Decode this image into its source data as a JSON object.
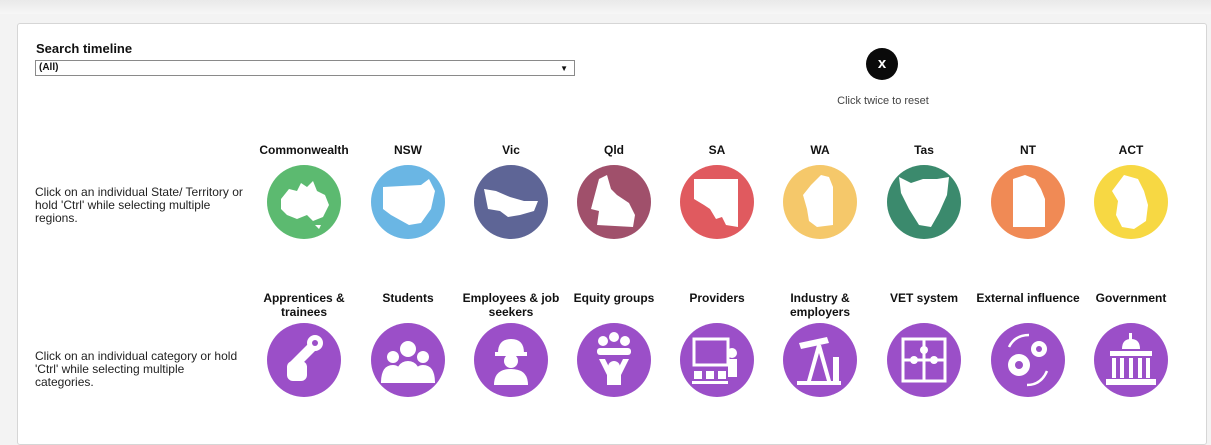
{
  "search": {
    "label": "Search timeline",
    "value": "(All)",
    "dropdown_arrow": "▼"
  },
  "reset": {
    "button_label": "x",
    "hint": "Click twice to reset"
  },
  "regions": {
    "instruction": "Click on an individual State/ Territory or hold 'Ctrl' while selecting multiple regions.",
    "items": [
      {
        "label": "Commonwealth",
        "color": "#5cba70",
        "icon": "australia-map-icon"
      },
      {
        "label": "NSW",
        "color": "#6ab6e4",
        "icon": "nsw-map-icon"
      },
      {
        "label": "Vic",
        "color": "#5e6596",
        "icon": "vic-map-icon"
      },
      {
        "label": "Qld",
        "color": "#a0506b",
        "icon": "qld-map-icon"
      },
      {
        "label": "SA",
        "color": "#e05a5f",
        "icon": "sa-map-icon"
      },
      {
        "label": "WA",
        "color": "#f5c86a",
        "icon": "wa-map-icon"
      },
      {
        "label": "Tas",
        "color": "#3b8a6d",
        "icon": "tas-map-icon"
      },
      {
        "label": "NT",
        "color": "#f08a55",
        "icon": "nt-map-icon"
      },
      {
        "label": "ACT",
        "color": "#f7d843",
        "icon": "act-map-icon"
      }
    ]
  },
  "categories": {
    "instruction": "Click on an individual category or hold 'Ctrl' while selecting multiple categories.",
    "color": "#9b4fc8",
    "items": [
      {
        "label": "Apprentices & trainees",
        "icon": "wrench-hand-icon"
      },
      {
        "label": "Students",
        "icon": "group-people-icon"
      },
      {
        "label": "Employees & job seekers",
        "icon": "hardhat-worker-icon"
      },
      {
        "label": "Equity groups",
        "icon": "community-icon"
      },
      {
        "label": "Providers",
        "icon": "presenter-board-icon"
      },
      {
        "label": "Industry & employers",
        "icon": "oil-pump-icon"
      },
      {
        "label": "VET system",
        "icon": "puzzle-icon"
      },
      {
        "label": "External influence",
        "icon": "gears-cycle-icon"
      },
      {
        "label": "Government",
        "icon": "parliament-building-icon"
      }
    ]
  }
}
